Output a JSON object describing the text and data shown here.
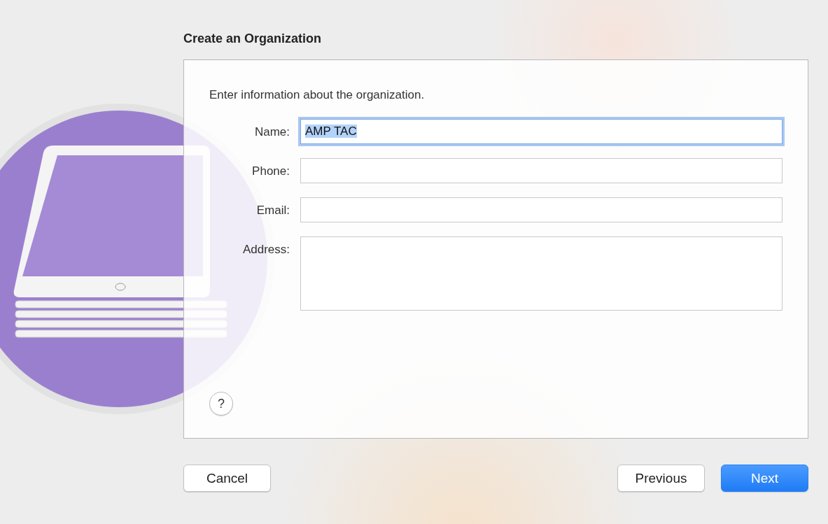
{
  "title": "Create an Organization",
  "instruction": "Enter information about the organization.",
  "fields": [
    {
      "label": "Name:",
      "value": "AMP TAC",
      "kind": "line",
      "focused": true
    },
    {
      "label": "Phone:",
      "kind": "line",
      "focused": false
    },
    {
      "label": "Email:",
      "kind": "line",
      "focused": false
    },
    {
      "label": "Address:",
      "kind": "area",
      "focused": false
    }
  ],
  "help": "?",
  "buttons": [
    {
      "label": "Cancel",
      "kind": "default"
    },
    {
      "label": "Previous",
      "kind": "default"
    },
    {
      "label": "Next",
      "kind": "primary"
    }
  ]
}
